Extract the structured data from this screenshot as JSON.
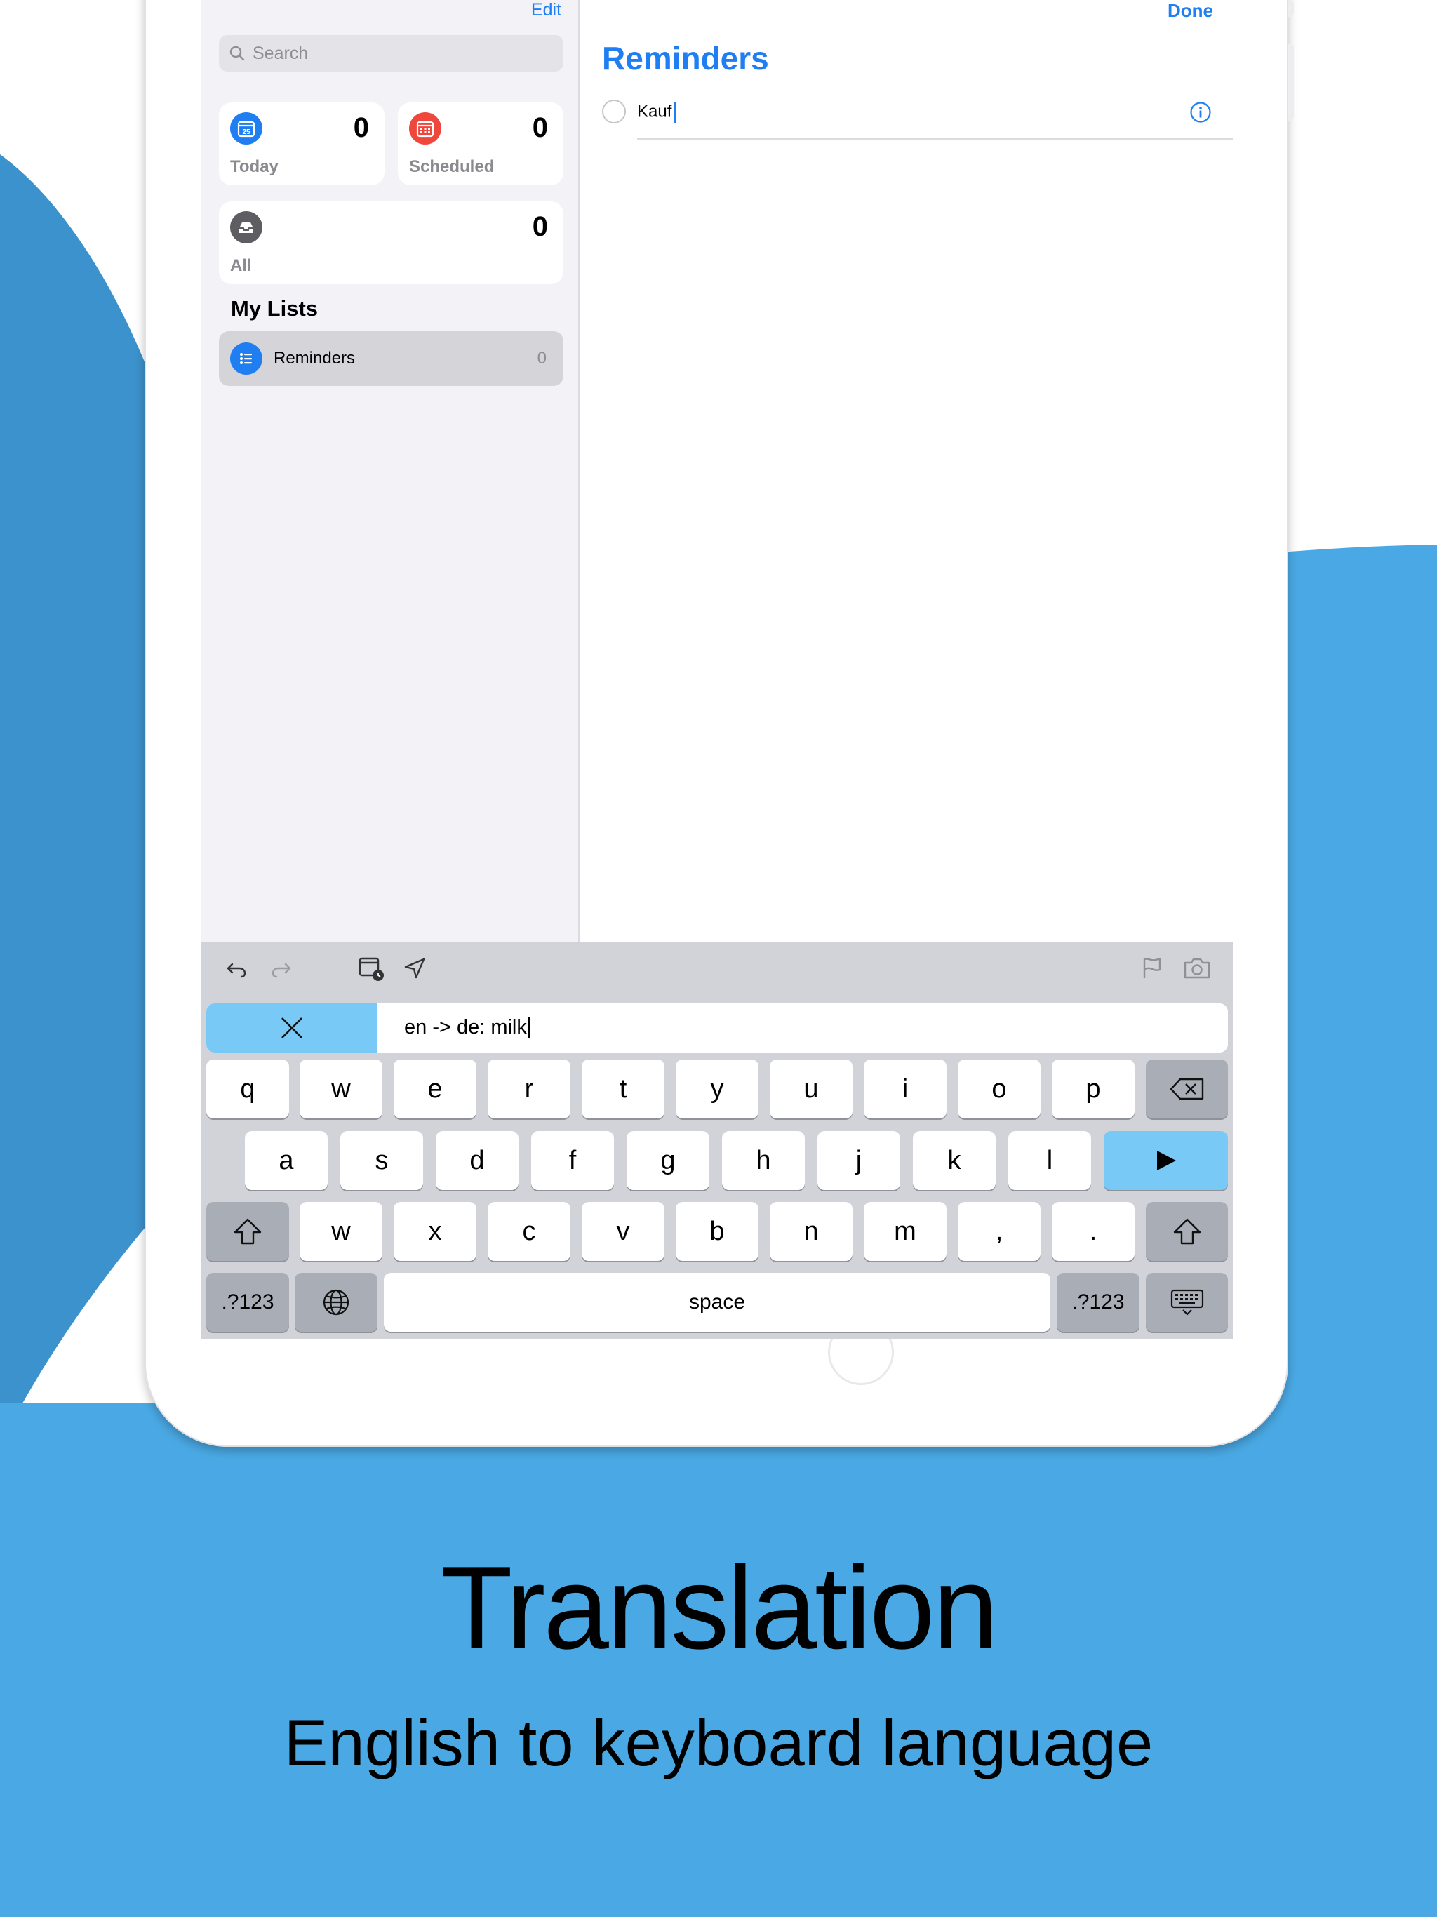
{
  "colors": {
    "accent": "#1f7ef1",
    "background_blue": "#4aa9e4",
    "translate_highlight": "#79c9f7",
    "scheduled_red": "#f0473d",
    "all_gray": "#5d5d62"
  },
  "sidebar": {
    "edit_label": "Edit",
    "search_placeholder": "Search",
    "cards": [
      {
        "label": "Today",
        "count": "0",
        "icon": "calendar-today-icon",
        "icon_text": "25"
      },
      {
        "label": "Scheduled",
        "count": "0",
        "icon": "calendar-scheduled-icon"
      },
      {
        "label": "All",
        "count": "0",
        "icon": "tray-icon"
      }
    ],
    "my_lists_title": "My Lists",
    "lists": [
      {
        "label": "Reminders",
        "count": "0",
        "icon": "list-bullet-icon"
      }
    ]
  },
  "detail": {
    "done_label": "Done",
    "title": "Reminders",
    "reminder_text": "Kauf"
  },
  "keyboard": {
    "toolbar": [
      "undo-icon",
      "redo-icon",
      "calendar-clock-icon",
      "location-arrow-icon",
      "flag-icon",
      "camera-icon"
    ],
    "translation_input": "en -> de: milk",
    "row1": [
      "q",
      "w",
      "e",
      "r",
      "t",
      "y",
      "u",
      "i",
      "o",
      "p"
    ],
    "row2": [
      "a",
      "s",
      "d",
      "f",
      "g",
      "h",
      "j",
      "k",
      "l"
    ],
    "row3": [
      "w",
      "x",
      "c",
      "v",
      "b",
      "n",
      "m",
      ",",
      "."
    ],
    "numbers_label": ".?123",
    "space_label": "space"
  },
  "marketing": {
    "headline": "Translation",
    "subline": "English to keyboard language"
  }
}
